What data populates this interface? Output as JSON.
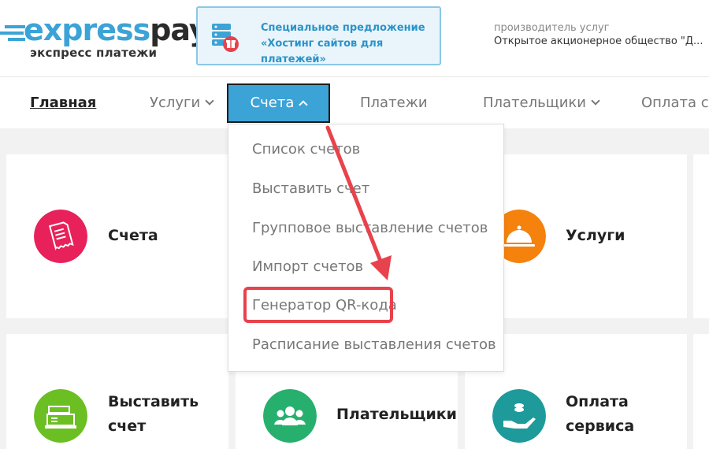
{
  "header": {
    "logo": {
      "part_a": "express",
      "part_b": "pay",
      "subtitle": "экспресс платежи"
    },
    "promo": {
      "line1": "Специальное предложение",
      "line2": "«Хостинг сайтов для платежей»",
      "icon": "server-gift-icon"
    },
    "provider": {
      "label": "производитель услуг",
      "name": "Открытое акционерное общество \"Д..."
    }
  },
  "nav": {
    "items": [
      {
        "label": "Главная"
      },
      {
        "label": "Услуги"
      },
      {
        "label": "Счета"
      },
      {
        "label": "Платежи"
      },
      {
        "label": "Плательщики"
      },
      {
        "label": "Оплата се"
      }
    ]
  },
  "dropdown": {
    "items": [
      {
        "label": "Список счетов"
      },
      {
        "label": "Выставить счет"
      },
      {
        "label": "Групповое выставление счетов"
      },
      {
        "label": "Импорт счетов"
      },
      {
        "label": "Генератор QR-кода"
      },
      {
        "label": "Расписание выставления счетов"
      }
    ]
  },
  "cards": [
    {
      "title": "Счета",
      "icon": "invoice-icon",
      "color": "#e8215a"
    },
    {
      "title": "Услуги",
      "icon": "service-bell-icon",
      "color": "#f5820d"
    },
    {
      "title_line1": "Выставить",
      "title_line2": "счет",
      "icon": "cash-register-icon",
      "color": "#6bbf23"
    },
    {
      "title": "Плательщики",
      "icon": "payers-icon",
      "color": "#27b06d"
    },
    {
      "title_line1": "Оплата",
      "title_line2": "сервиса",
      "icon": "hand-coin-icon",
      "color": "#1e9a9a"
    }
  ],
  "colors": {
    "accent": "#3ca3d6",
    "highlight": "#e8424c"
  }
}
